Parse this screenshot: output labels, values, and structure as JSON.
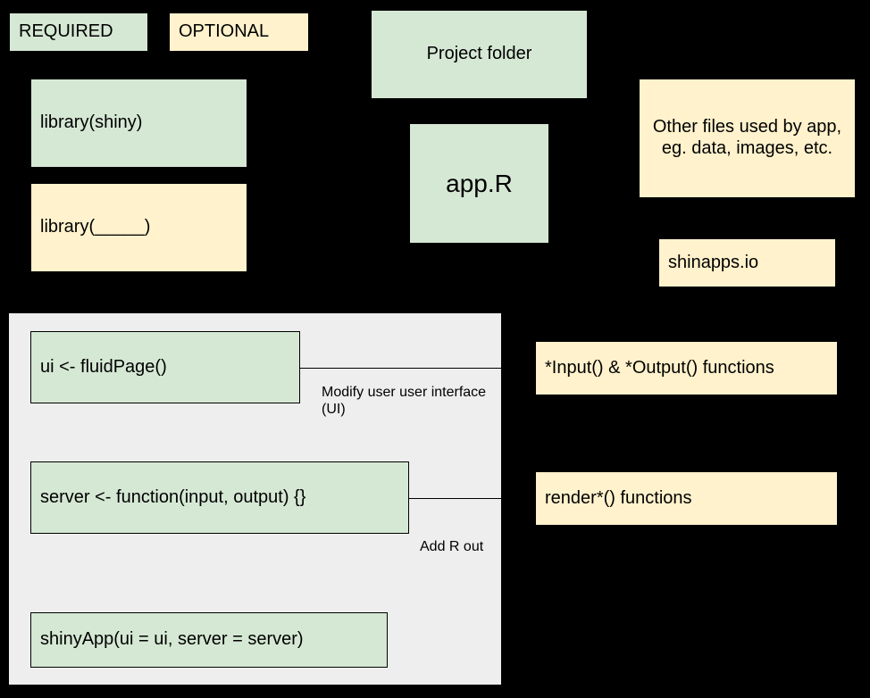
{
  "diagram": {
    "title": "R Shiny app structure diagram",
    "colors": {
      "required": "#d5e8d4",
      "optional": "#fff2cc",
      "panel": "#eeeeee",
      "stroke": "#000000",
      "background": "#000000"
    },
    "legend": [
      {
        "id": "required",
        "label": "REQUIRED",
        "type": "required"
      },
      {
        "id": "optional",
        "label": "OPTIONAL",
        "type": "optional"
      }
    ],
    "nodes": [
      {
        "id": "library-shiny",
        "label": "library(shiny)",
        "type": "required"
      },
      {
        "id": "library-blank",
        "label": "library(_____)",
        "type": "optional"
      },
      {
        "id": "project-folder",
        "label": "Project folder",
        "type": "required"
      },
      {
        "id": "app-r",
        "label": "app.R",
        "type": "required"
      },
      {
        "id": "other-files",
        "label": "Other files used by app, eg. data, images, etc.",
        "type": "optional"
      },
      {
        "id": "shinyapps-io",
        "label": "shinapps.io",
        "type": "optional"
      },
      {
        "id": "ui-fluidpage",
        "label": "ui <- fluidPage()",
        "type": "required"
      },
      {
        "id": "server-function",
        "label": "server <- function(input, output) {}",
        "type": "required"
      },
      {
        "id": "shinyapp-call",
        "label": "shinyApp(ui = ui, server = server)",
        "type": "required"
      },
      {
        "id": "input-output-functions",
        "label": "*Input() & *Output() functions",
        "type": "optional"
      },
      {
        "id": "render-functions",
        "label": "render*() functions",
        "type": "optional"
      }
    ],
    "edges": [
      {
        "id": "ui-to-input-output",
        "from": "ui-fluidpage",
        "to": "input-output-functions",
        "label": "Modify user user interface (UI)"
      },
      {
        "id": "server-to-render",
        "from": "server-function",
        "to": "render-functions",
        "label": "Add R out"
      }
    ]
  }
}
